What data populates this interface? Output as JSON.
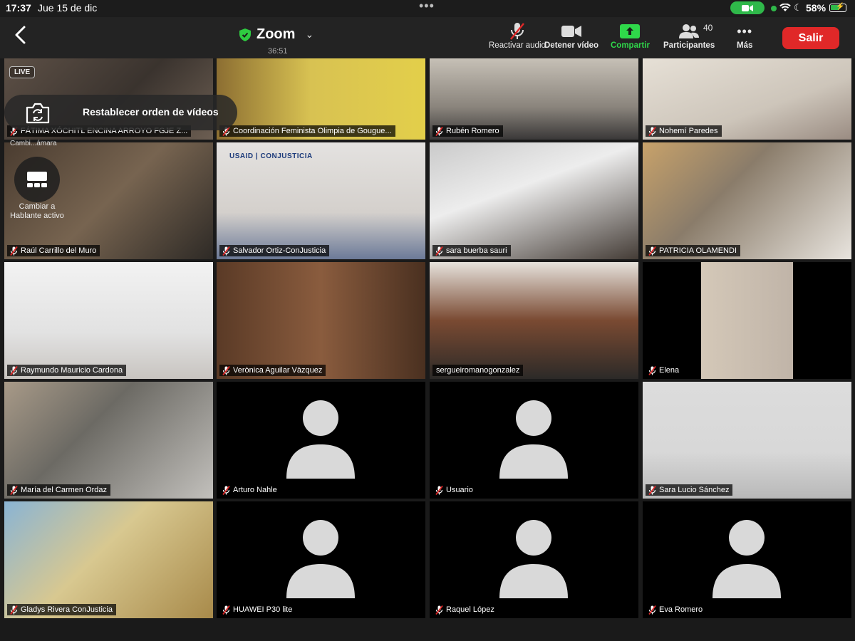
{
  "status_bar": {
    "time": "17:37",
    "date": "Jue 15 de dic",
    "battery": "58%",
    "camera_icon": "video-camera-icon",
    "wifi_icon": "wifi-icon",
    "moon_icon": "do-not-disturb-icon"
  },
  "toolbar": {
    "title": "Zoom",
    "timer": "36:51",
    "buttons": {
      "audio": "Reactivar audio",
      "video": "Detener vídeo",
      "share": "Compartir",
      "participants": "Participantes",
      "participants_count": "40",
      "more": "Más",
      "leave": "Salir"
    },
    "colors": {
      "share": "#2fd84a",
      "leave": "#e02828",
      "active_speaker": "#2ecc40"
    }
  },
  "overlay": {
    "live": "LIVE",
    "reorder": "Restablecer orden de vídeos",
    "camera_switch": "Cambi...ámara",
    "speaker_view": "Cambiar a Hablante activo"
  },
  "participants": [
    {
      "name": "FÁTIMA XÓCHITL ENCINA ARROYO FGJE Z...",
      "video": true,
      "muted": true
    },
    {
      "name": "Coordinación Feminista Olimpia de Gougue...",
      "video": true,
      "muted": true
    },
    {
      "name": "Rubén Romero",
      "video": true,
      "muted": true
    },
    {
      "name": "Nohemí Paredes",
      "video": true,
      "muted": true
    },
    {
      "name": "Raúl Carrillo del Muro",
      "video": true,
      "muted": true
    },
    {
      "name": "Salvador Ortiz-ConJusticia",
      "video": true,
      "muted": true,
      "logo": "USAID | CONJUSTICIA"
    },
    {
      "name": "sara buerba sauri",
      "video": true,
      "muted": true
    },
    {
      "name": "PATRICIA OLAMENDI",
      "video": true,
      "muted": true
    },
    {
      "name": "Raymundo Mauricio Cardona",
      "video": true,
      "muted": true
    },
    {
      "name": "Verònica Aguilar Vàzquez",
      "video": true,
      "muted": true
    },
    {
      "name": "sergueiromanogonzalez",
      "video": true,
      "muted": false,
      "active": true
    },
    {
      "name": "Elena",
      "video": true,
      "muted": true
    },
    {
      "name": "María del Carmen Ordaz",
      "video": true,
      "muted": true
    },
    {
      "name": "Arturo Nahle",
      "video": false,
      "muted": true
    },
    {
      "name": "Usuario",
      "video": false,
      "muted": true
    },
    {
      "name": "Sara Lucio Sánchez",
      "video": true,
      "muted": true
    },
    {
      "name": "Gladys Rivera ConJusticia",
      "video": true,
      "muted": true
    },
    {
      "name": "HUAWEI P30 lite",
      "video": false,
      "muted": true
    },
    {
      "name": "Raquel López",
      "video": false,
      "muted": true
    },
    {
      "name": "Eva Romero",
      "video": false,
      "muted": true
    }
  ]
}
